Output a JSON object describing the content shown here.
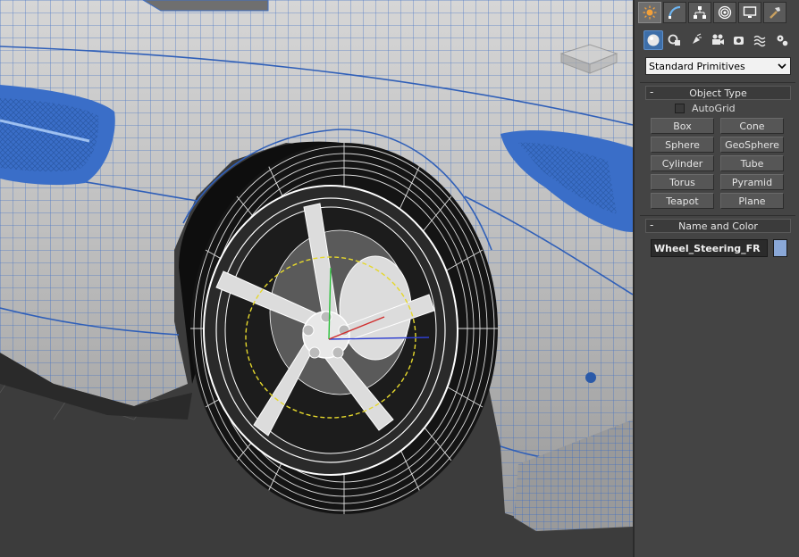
{
  "viewport": {
    "name": "perspective-viewport",
    "selected_object": "Wheel_Steering_FR"
  },
  "command_panel": {
    "main_tabs": [
      {
        "name": "create-tab",
        "icon": "sun-icon",
        "active": true
      },
      {
        "name": "modify-tab",
        "icon": "curve-icon",
        "active": false
      },
      {
        "name": "hierarchy-tab",
        "icon": "hierarchy-icon",
        "active": false
      },
      {
        "name": "motion-tab",
        "icon": "motion-icon",
        "active": false
      },
      {
        "name": "display-tab",
        "icon": "monitor-icon",
        "active": false
      },
      {
        "name": "utilities-tab",
        "icon": "hammer-icon",
        "active": false
      }
    ],
    "sub_tabs": [
      {
        "name": "geometry",
        "icon": "sphere-icon",
        "active": true
      },
      {
        "name": "shapes",
        "icon": "shapes-icon",
        "active": false
      },
      {
        "name": "lights",
        "icon": "light-icon",
        "active": false
      },
      {
        "name": "cameras",
        "icon": "camera-icon",
        "active": false
      },
      {
        "name": "helpers",
        "icon": "helper-icon",
        "active": false
      },
      {
        "name": "space-warps",
        "icon": "wave-icon",
        "active": false
      },
      {
        "name": "systems",
        "icon": "gears-icon",
        "active": false
      }
    ],
    "category_dropdown": {
      "value": "Standard Primitives"
    },
    "object_type": {
      "title": "Object Type",
      "collapse": "-",
      "autogrid_label": "AutoGrid",
      "autogrid_checked": false,
      "buttons": [
        "Box",
        "Cone",
        "Sphere",
        "GeoSphere",
        "Cylinder",
        "Tube",
        "Torus",
        "Pyramid",
        "Teapot",
        "Plane"
      ]
    },
    "name_and_color": {
      "title": "Name and Color",
      "collapse": "-",
      "name_value": "Wheel_Steering_FR",
      "color": "#8aa8d8"
    }
  },
  "colors": {
    "panel_bg": "#444444",
    "wire_blue": "#3f6fc4",
    "wire_white": "#ffffff",
    "body_gray": "#c9c9c9"
  }
}
